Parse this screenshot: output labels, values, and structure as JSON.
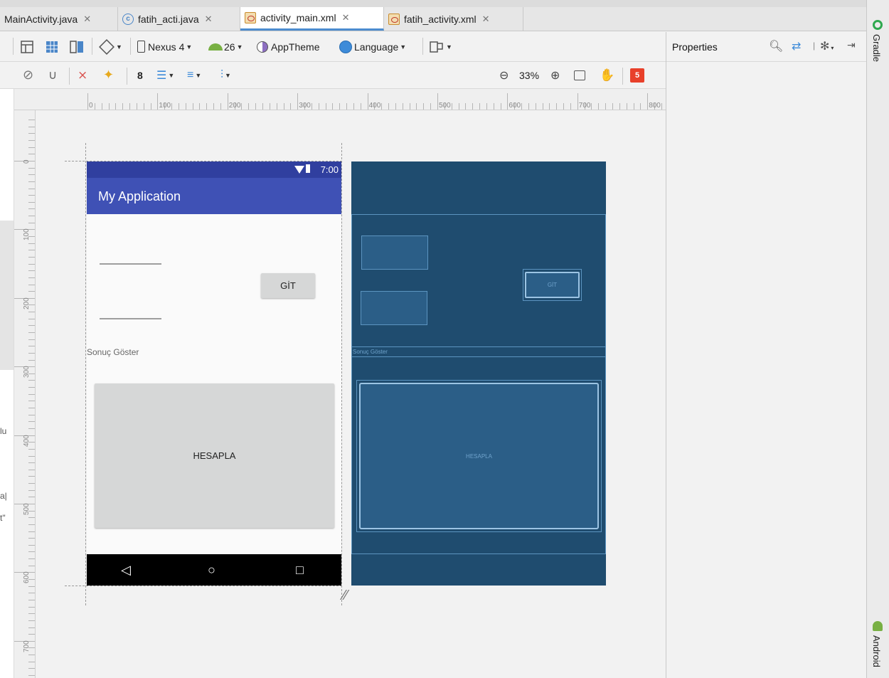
{
  "tabs": [
    {
      "label": "MainActivity.java",
      "icon": "java-class-icon"
    },
    {
      "label": "fatih_acti.java",
      "icon": "java-class-icon"
    },
    {
      "label": "activity_main.xml",
      "icon": "xml-layout-icon",
      "active": true
    },
    {
      "label": "fatih_activity.xml",
      "icon": "xml-layout-icon"
    }
  ],
  "toolbar": {
    "device": "Nexus 4",
    "api": "26",
    "theme": "AppTheme",
    "language": "Language",
    "constraint_margin": "8",
    "zoom": "33%",
    "warnings": "5"
  },
  "properties": {
    "title": "Properties"
  },
  "sidebar": {
    "gradle": "Gradle",
    "android": "Android"
  },
  "ruler": {
    "h_labels": [
      "0",
      "100",
      "200",
      "300",
      "400",
      "500",
      "600",
      "700",
      "800"
    ],
    "v_labels": [
      "0",
      "100",
      "200",
      "300",
      "400",
      "500",
      "600",
      "700"
    ]
  },
  "gutter_fragments": [
    "lu",
    "a|",
    "t\""
  ],
  "phone": {
    "status_time": "7:00",
    "app_title": "My Application",
    "git_label": "GİT",
    "result_text": "Sonuç Göster",
    "calc_label": "HESAPLA",
    "nav_back": "◁",
    "nav_home": "○",
    "nav_recent": "□"
  },
  "blueprint": {
    "git_label": "GİT",
    "result_text": "Sonuç Göster",
    "calc_label": "HESAPLA"
  },
  "colors": {
    "primary": "#3f51b5",
    "primary_dark": "#303f9f",
    "blueprint_bg": "#1f4c6f",
    "warning_badge": "#e8402a"
  }
}
